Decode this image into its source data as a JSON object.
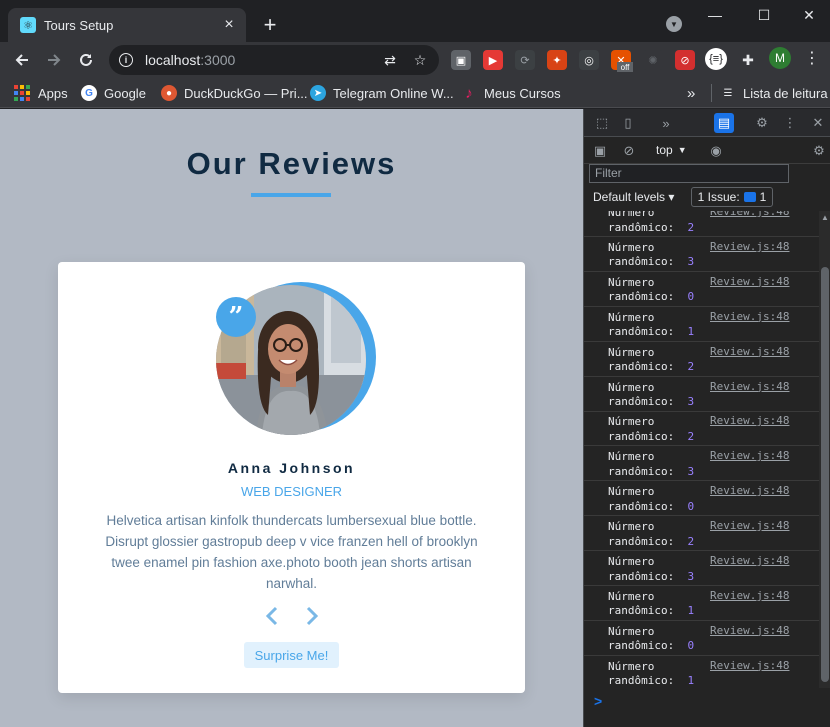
{
  "browser": {
    "tab_title": "Tours Setup",
    "tab_close": "×",
    "new_tab": "+",
    "window_controls": {
      "minimize": "—",
      "maximize": "☐",
      "close": "✕"
    },
    "url_host": "localhost",
    "url_port": ":3000",
    "extension_badge": "off",
    "profile_initial": "M",
    "bookmarks": [
      {
        "label": "Apps",
        "icon": "apps-grid-icon"
      },
      {
        "label": "Google",
        "icon": "google-icon",
        "color": "#4285f4"
      },
      {
        "label": "DuckDuckGo — Pri...",
        "icon": "duckduckgo-icon",
        "color": "#de5833"
      },
      {
        "label": "Telegram Online W...",
        "icon": "telegram-icon",
        "color": "#2ca5e0"
      },
      {
        "label": "Meus Cursos",
        "icon": "music-note-icon",
        "color": "#e91e63"
      }
    ],
    "reading_list": "Lista de leitura",
    "overflow": "»"
  },
  "page": {
    "title": "Our Reviews",
    "review": {
      "quote_mark": "”",
      "name": "Anna Johnson",
      "job": "web designer",
      "text": "Helvetica artisan kinfolk thundercats lumbersexual blue bottle. Disrupt glossier gastropub deep v vice franzen hell of brooklyn twee enamel pin fashion axe.photo booth jean shorts artisan narwhal.",
      "surprise_label": "Surprise Me!"
    },
    "colors": {
      "accent": "#49a6e9",
      "heading": "#102a42",
      "background": "#b2b9c4"
    }
  },
  "devtools": {
    "context": "top",
    "filter_placeholder": "Filter",
    "levels": "Default levels ▾",
    "issues_label": "1 Issue:",
    "issues_count": "1",
    "log_label_1": "Núrmero",
    "log_label_2": "randômico:",
    "log_source": "Review.js:48",
    "logs": [
      {
        "value": "2",
        "partial": true
      },
      {
        "value": "3"
      },
      {
        "value": "0"
      },
      {
        "value": "1"
      },
      {
        "value": "2"
      },
      {
        "value": "3"
      },
      {
        "value": "2"
      },
      {
        "value": "3"
      },
      {
        "value": "0"
      },
      {
        "value": "2"
      },
      {
        "value": "3"
      },
      {
        "value": "1"
      },
      {
        "value": "0"
      },
      {
        "value": "1"
      }
    ],
    "prompt": ">"
  }
}
